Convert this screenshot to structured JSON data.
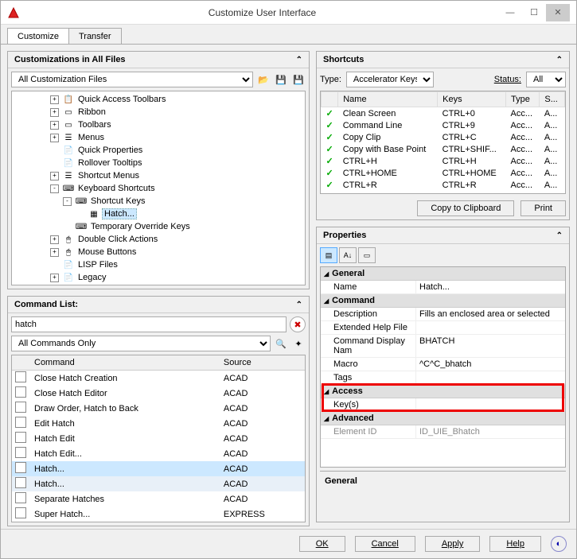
{
  "window": {
    "title": "Customize User Interface"
  },
  "tabs": {
    "customize": "Customize",
    "transfer": "Transfer"
  },
  "customizations": {
    "title": "Customizations in All Files",
    "filter": "All Customization Files",
    "tree": [
      {
        "indent": 3,
        "exp": "+",
        "icon": "📋",
        "label": "Quick Access Toolbars"
      },
      {
        "indent": 3,
        "exp": "+",
        "icon": "▭",
        "label": "Ribbon"
      },
      {
        "indent": 3,
        "exp": "+",
        "icon": "▭",
        "label": "Toolbars"
      },
      {
        "indent": 3,
        "exp": "+",
        "icon": "☰",
        "label": "Menus"
      },
      {
        "indent": 3,
        "exp": "",
        "icon": "📄",
        "label": "Quick Properties"
      },
      {
        "indent": 3,
        "exp": "",
        "icon": "📄",
        "label": "Rollover Tooltips"
      },
      {
        "indent": 3,
        "exp": "+",
        "icon": "☰",
        "label": "Shortcut Menus"
      },
      {
        "indent": 3,
        "exp": "-",
        "icon": "⌨",
        "label": "Keyboard Shortcuts"
      },
      {
        "indent": 4,
        "exp": "-",
        "icon": "⌨",
        "label": "Shortcut Keys"
      },
      {
        "indent": 5,
        "exp": "",
        "icon": "▦",
        "label": "Hatch...",
        "sel": true
      },
      {
        "indent": 4,
        "exp": "",
        "icon": "⌨",
        "label": "Temporary Override Keys"
      },
      {
        "indent": 3,
        "exp": "+",
        "icon": "🖱",
        "label": "Double Click Actions"
      },
      {
        "indent": 3,
        "exp": "+",
        "icon": "🖱",
        "label": "Mouse Buttons"
      },
      {
        "indent": 3,
        "exp": "",
        "icon": "📄",
        "label": "LISP Files"
      },
      {
        "indent": 3,
        "exp": "+",
        "icon": "📄",
        "label": "Legacy"
      }
    ]
  },
  "commandList": {
    "title": "Command List:",
    "search": "hatch",
    "filter": "All Commands Only",
    "cols": {
      "cmd": "Command",
      "src": "Source"
    },
    "rows": [
      {
        "cmd": "Close Hatch Creation",
        "src": "ACAD"
      },
      {
        "cmd": "Close Hatch Editor",
        "src": "ACAD"
      },
      {
        "cmd": "Draw Order, Hatch to Back",
        "src": "ACAD"
      },
      {
        "cmd": "Edit Hatch",
        "src": "ACAD"
      },
      {
        "cmd": "Hatch Edit",
        "src": "ACAD"
      },
      {
        "cmd": "Hatch Edit...",
        "src": "ACAD"
      },
      {
        "cmd": "Hatch...",
        "src": "ACAD",
        "sel": 1
      },
      {
        "cmd": "Hatch...",
        "src": "ACAD",
        "sel": 2
      },
      {
        "cmd": "Separate Hatches",
        "src": "ACAD"
      },
      {
        "cmd": "Super Hatch...",
        "src": "EXPRESS"
      }
    ]
  },
  "shortcuts": {
    "title": "Shortcuts",
    "typeLabel": "Type:",
    "typeValue": "Accelerator Keys",
    "statusLabel": "Status:",
    "statusValue": "All",
    "cols": {
      "name": "Name",
      "keys": "Keys",
      "type": "Type",
      "src": "S..."
    },
    "rows": [
      {
        "name": "Clean Screen",
        "keys": "CTRL+0",
        "type": "Acc...",
        "src": "A..."
      },
      {
        "name": "Command Line",
        "keys": "CTRL+9",
        "type": "Acc...",
        "src": "A..."
      },
      {
        "name": "Copy Clip",
        "keys": "CTRL+C",
        "type": "Acc...",
        "src": "A..."
      },
      {
        "name": "Copy with Base Point",
        "keys": "CTRL+SHIF...",
        "type": "Acc...",
        "src": "A..."
      },
      {
        "name": "CTRL+H",
        "keys": "CTRL+H",
        "type": "Acc...",
        "src": "A..."
      },
      {
        "name": "CTRL+HOME",
        "keys": "CTRL+HOME",
        "type": "Acc...",
        "src": "A..."
      },
      {
        "name": "CTRL+R",
        "keys": "CTRL+R",
        "type": "Acc...",
        "src": "A..."
      }
    ],
    "copyBtn": "Copy to Clipboard",
    "printBtn": "Print"
  },
  "properties": {
    "title": "Properties",
    "sections": {
      "general": "General",
      "command": "Command",
      "access": "Access",
      "advanced": "Advanced"
    },
    "rows": {
      "name_k": "Name",
      "name_v": "Hatch...",
      "desc_k": "Description",
      "desc_v": "Fills an enclosed area or selected",
      "ext_k": "Extended Help File",
      "ext_v": "",
      "cdn_k": "Command Display Nam",
      "cdn_v": "BHATCH",
      "macro_k": "Macro",
      "macro_v": "^C^C_bhatch",
      "tags_k": "Tags",
      "tags_v": "",
      "keys_k": "Key(s)",
      "keys_v": "",
      "elid_k": "Element ID",
      "elid_v": "ID_UIE_Bhatch"
    },
    "descTitle": "General"
  },
  "footer": {
    "ok": "OK",
    "cancel": "Cancel",
    "apply": "Apply",
    "help": "Help"
  }
}
